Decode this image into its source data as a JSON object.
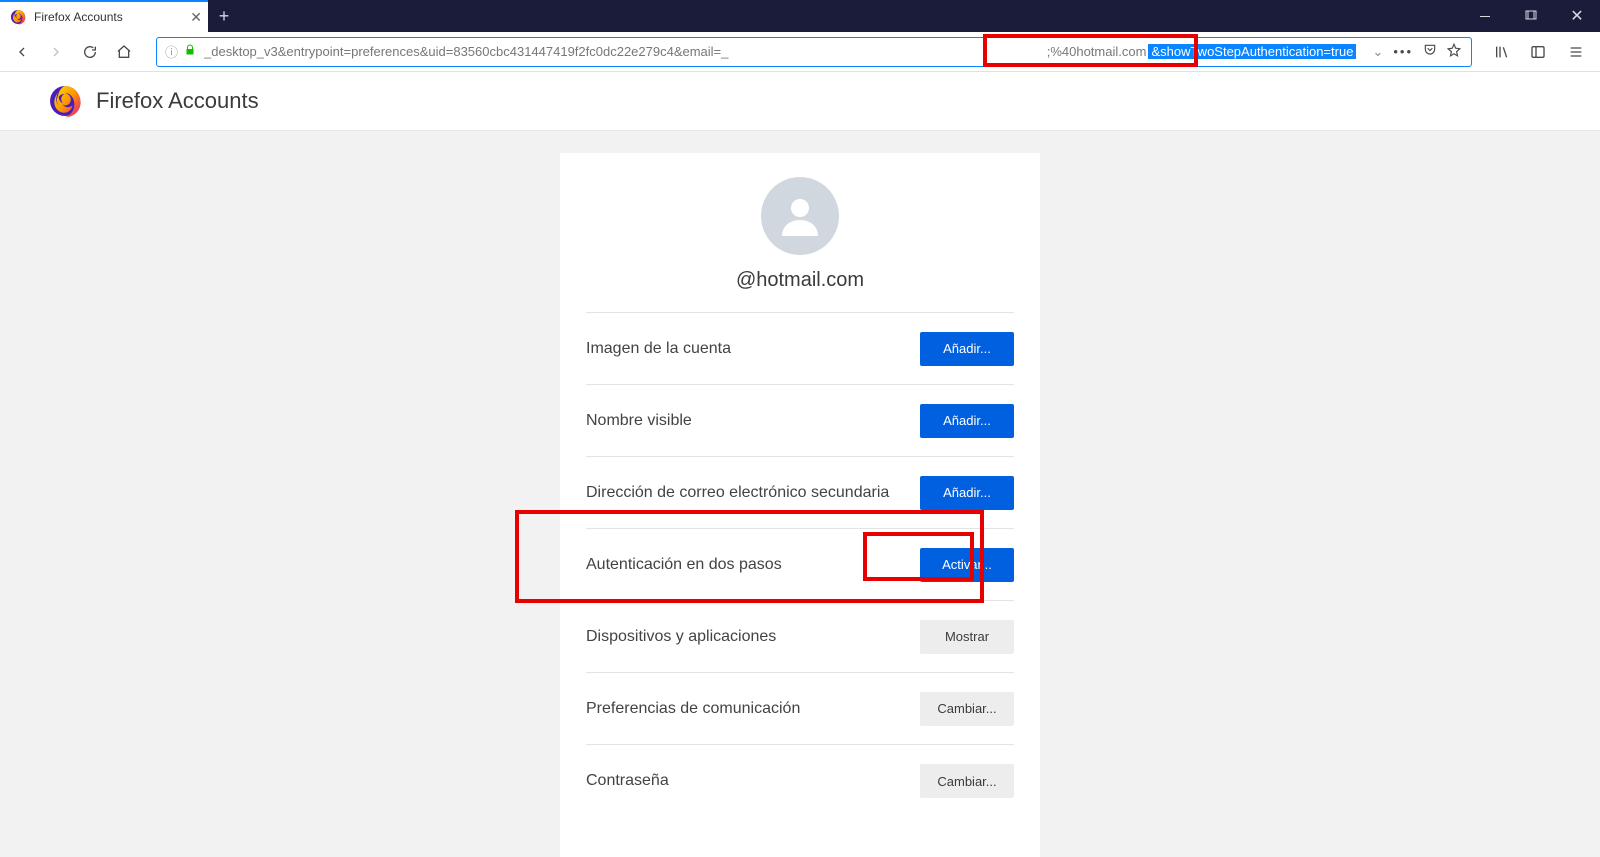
{
  "tab": {
    "title": "Firefox Accounts"
  },
  "url": {
    "left": "_desktop_v3&entrypoint=preferences&uid=83560cbc431447419f2fc0dc22e279c4&email=_",
    "mid": ";%40hotmail.com",
    "highlight": "&showTwoStepAuthentication=true"
  },
  "header": {
    "title": "Firefox Accounts"
  },
  "account": {
    "email": "@hotmail.com"
  },
  "rows": {
    "image": {
      "label": "Imagen de la cuenta",
      "button": "Añadir...",
      "style": "primary"
    },
    "name": {
      "label": "Nombre visible",
      "button": "Añadir...",
      "style": "primary"
    },
    "email2": {
      "label": "Dirección de correo electrónico secundaria",
      "button": "Añadir...",
      "style": "primary"
    },
    "twostep": {
      "label": "Autenticación en dos pasos",
      "button": "Activar...",
      "style": "primary"
    },
    "devices": {
      "label": "Dispositivos y aplicaciones",
      "button": "Mostrar",
      "style": "secondary"
    },
    "comms": {
      "label": "Preferencias de comunicación",
      "button": "Cambiar...",
      "style": "secondary"
    },
    "password": {
      "label": "Contraseña",
      "button": "Cambiar...",
      "style": "secondary"
    }
  }
}
